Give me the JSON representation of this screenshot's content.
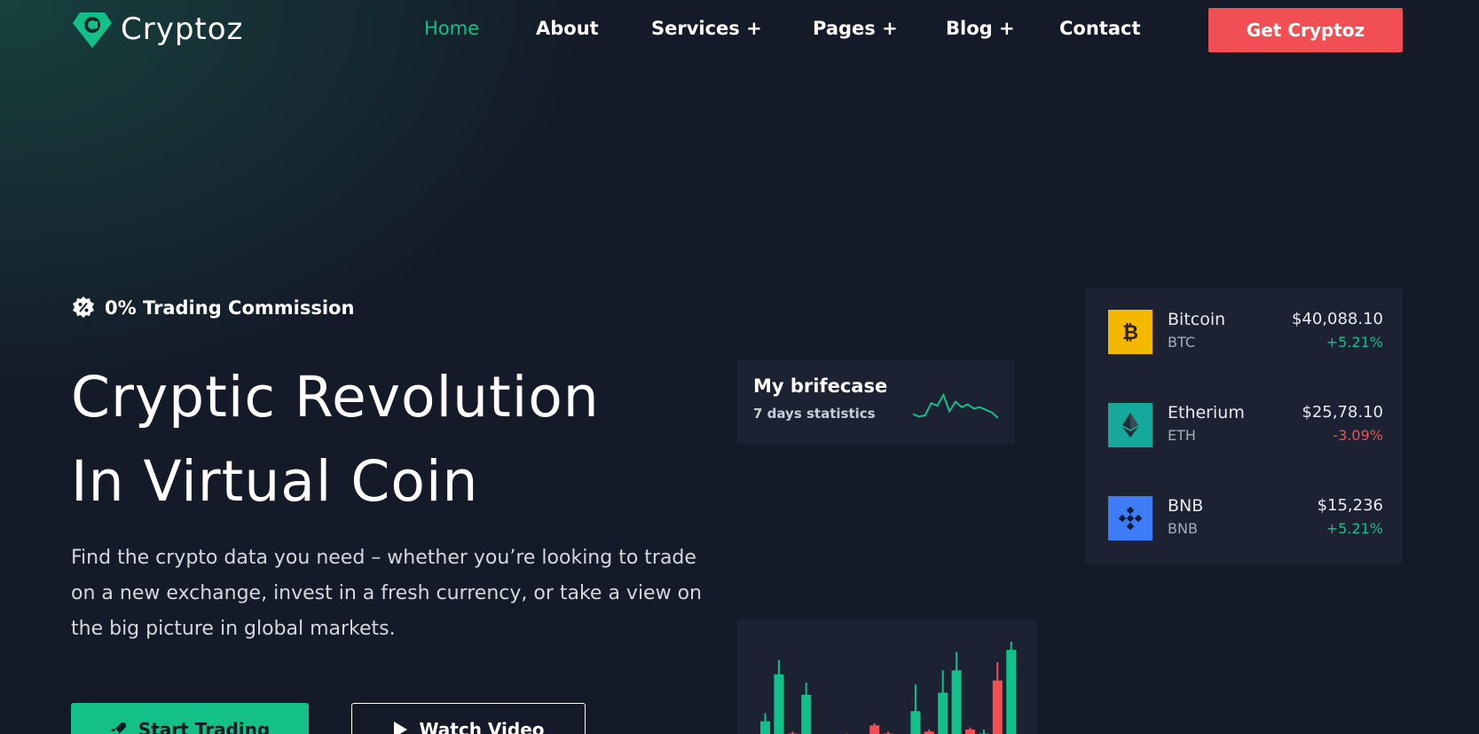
{
  "header": {
    "brand": "Cryptoz",
    "nav": [
      "Home",
      "About",
      "Services +",
      "Pages +",
      "Blog +",
      "Contact"
    ],
    "active_index": 0,
    "cta": "Get Cryptoz"
  },
  "hero": {
    "badge": "0% Trading Commission",
    "title_line1": "Cryptic Revolution",
    "title_line2": "In Virtual Coin",
    "description": "Find the crypto data you need – whether you’re looking to trade on a new exchange, invest in a fresh currency, or take a view on the big picture in global markets.",
    "primary_button": "Start Trading",
    "secondary_button": "Watch Video"
  },
  "briefcase": {
    "title": "My brifecase",
    "subtitle": "7 days statistics",
    "sparkline": [
      6,
      4,
      5,
      14,
      12,
      20,
      8,
      15,
      11,
      13,
      10,
      11,
      9,
      7,
      3
    ]
  },
  "coins": [
    {
      "name": "Bitcoin",
      "symbol": "BTC",
      "price": "$40,088.10",
      "change": "+5.21%",
      "direction": "up",
      "icon": "bitcoin-icon",
      "color": "#f5b800"
    },
    {
      "name": "Etherium",
      "symbol": "ETH",
      "price": "$25,78.10",
      "change": "-3.09%",
      "direction": "down",
      "icon": "ethereum-icon",
      "color": "#16a89a"
    },
    {
      "name": "BNB",
      "symbol": "BNB",
      "price": "$15,236",
      "change": "+5.21%",
      "direction": "up",
      "icon": "bnb-icon",
      "color": "#3d7bf7"
    }
  ],
  "colors": {
    "accent": "#12c088",
    "danger": "#f14f53",
    "card": "#1c2232"
  },
  "candles": [
    {
      "o": 14,
      "c": 22,
      "h": 30,
      "l": 12,
      "up": true
    },
    {
      "o": 22,
      "c": 68,
      "h": 82,
      "l": 20,
      "up": true
    },
    {
      "o": 10,
      "c": 4,
      "h": 12,
      "l": 2,
      "up": false
    },
    {
      "o": 12,
      "c": 48,
      "h": 60,
      "l": 10,
      "up": true
    },
    {
      "o": 6,
      "c": 4,
      "h": 8,
      "l": 2,
      "up": false
    },
    {
      "o": 4,
      "c": 6,
      "h": 8,
      "l": 2,
      "up": true
    },
    {
      "o": 8,
      "c": 6,
      "h": 10,
      "l": 4,
      "up": false
    },
    {
      "o": 4,
      "c": 6,
      "h": 8,
      "l": 2,
      "up": true
    },
    {
      "o": 18,
      "c": 10,
      "h": 20,
      "l": 8,
      "up": false
    },
    {
      "o": 10,
      "c": 6,
      "h": 12,
      "l": 4,
      "up": false
    },
    {
      "o": 6,
      "c": 4,
      "h": 8,
      "l": 2,
      "up": false
    },
    {
      "o": 8,
      "c": 32,
      "h": 58,
      "l": 6,
      "up": true
    },
    {
      "o": 12,
      "c": 6,
      "h": 14,
      "l": 4,
      "up": false
    },
    {
      "o": 10,
      "c": 50,
      "h": 72,
      "l": 8,
      "up": true
    },
    {
      "o": 12,
      "c": 72,
      "h": 90,
      "l": 10,
      "up": true
    },
    {
      "o": 14,
      "c": 8,
      "h": 16,
      "l": 6,
      "up": false
    },
    {
      "o": 6,
      "c": 10,
      "h": 14,
      "l": 4,
      "up": true
    },
    {
      "o": 62,
      "c": 12,
      "h": 80,
      "l": 10,
      "up": false
    },
    {
      "o": 10,
      "c": 92,
      "h": 100,
      "l": 8,
      "up": true
    }
  ]
}
